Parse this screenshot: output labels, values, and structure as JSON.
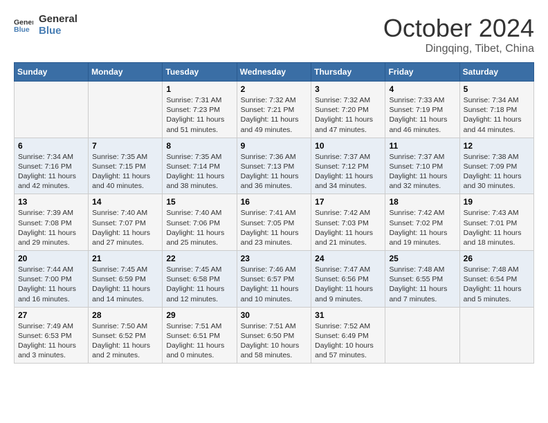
{
  "logo": {
    "line1": "General",
    "line2": "Blue"
  },
  "title": {
    "month": "October 2024",
    "location": "Dingqing, Tibet, China"
  },
  "headers": [
    "Sunday",
    "Monday",
    "Tuesday",
    "Wednesday",
    "Thursday",
    "Friday",
    "Saturday"
  ],
  "weeks": [
    [
      {
        "num": "",
        "lines": []
      },
      {
        "num": "",
        "lines": []
      },
      {
        "num": "1",
        "lines": [
          "Sunrise: 7:31 AM",
          "Sunset: 7:23 PM",
          "Daylight: 11 hours",
          "and 51 minutes."
        ]
      },
      {
        "num": "2",
        "lines": [
          "Sunrise: 7:32 AM",
          "Sunset: 7:21 PM",
          "Daylight: 11 hours",
          "and 49 minutes."
        ]
      },
      {
        "num": "3",
        "lines": [
          "Sunrise: 7:32 AM",
          "Sunset: 7:20 PM",
          "Daylight: 11 hours",
          "and 47 minutes."
        ]
      },
      {
        "num": "4",
        "lines": [
          "Sunrise: 7:33 AM",
          "Sunset: 7:19 PM",
          "Daylight: 11 hours",
          "and 46 minutes."
        ]
      },
      {
        "num": "5",
        "lines": [
          "Sunrise: 7:34 AM",
          "Sunset: 7:18 PM",
          "Daylight: 11 hours",
          "and 44 minutes."
        ]
      }
    ],
    [
      {
        "num": "6",
        "lines": [
          "Sunrise: 7:34 AM",
          "Sunset: 7:16 PM",
          "Daylight: 11 hours",
          "and 42 minutes."
        ]
      },
      {
        "num": "7",
        "lines": [
          "Sunrise: 7:35 AM",
          "Sunset: 7:15 PM",
          "Daylight: 11 hours",
          "and 40 minutes."
        ]
      },
      {
        "num": "8",
        "lines": [
          "Sunrise: 7:35 AM",
          "Sunset: 7:14 PM",
          "Daylight: 11 hours",
          "and 38 minutes."
        ]
      },
      {
        "num": "9",
        "lines": [
          "Sunrise: 7:36 AM",
          "Sunset: 7:13 PM",
          "Daylight: 11 hours",
          "and 36 minutes."
        ]
      },
      {
        "num": "10",
        "lines": [
          "Sunrise: 7:37 AM",
          "Sunset: 7:12 PM",
          "Daylight: 11 hours",
          "and 34 minutes."
        ]
      },
      {
        "num": "11",
        "lines": [
          "Sunrise: 7:37 AM",
          "Sunset: 7:10 PM",
          "Daylight: 11 hours",
          "and 32 minutes."
        ]
      },
      {
        "num": "12",
        "lines": [
          "Sunrise: 7:38 AM",
          "Sunset: 7:09 PM",
          "Daylight: 11 hours",
          "and 30 minutes."
        ]
      }
    ],
    [
      {
        "num": "13",
        "lines": [
          "Sunrise: 7:39 AM",
          "Sunset: 7:08 PM",
          "Daylight: 11 hours",
          "and 29 minutes."
        ]
      },
      {
        "num": "14",
        "lines": [
          "Sunrise: 7:40 AM",
          "Sunset: 7:07 PM",
          "Daylight: 11 hours",
          "and 27 minutes."
        ]
      },
      {
        "num": "15",
        "lines": [
          "Sunrise: 7:40 AM",
          "Sunset: 7:06 PM",
          "Daylight: 11 hours",
          "and 25 minutes."
        ]
      },
      {
        "num": "16",
        "lines": [
          "Sunrise: 7:41 AM",
          "Sunset: 7:05 PM",
          "Daylight: 11 hours",
          "and 23 minutes."
        ]
      },
      {
        "num": "17",
        "lines": [
          "Sunrise: 7:42 AM",
          "Sunset: 7:03 PM",
          "Daylight: 11 hours",
          "and 21 minutes."
        ]
      },
      {
        "num": "18",
        "lines": [
          "Sunrise: 7:42 AM",
          "Sunset: 7:02 PM",
          "Daylight: 11 hours",
          "and 19 minutes."
        ]
      },
      {
        "num": "19",
        "lines": [
          "Sunrise: 7:43 AM",
          "Sunset: 7:01 PM",
          "Daylight: 11 hours",
          "and 18 minutes."
        ]
      }
    ],
    [
      {
        "num": "20",
        "lines": [
          "Sunrise: 7:44 AM",
          "Sunset: 7:00 PM",
          "Daylight: 11 hours",
          "and 16 minutes."
        ]
      },
      {
        "num": "21",
        "lines": [
          "Sunrise: 7:45 AM",
          "Sunset: 6:59 PM",
          "Daylight: 11 hours",
          "and 14 minutes."
        ]
      },
      {
        "num": "22",
        "lines": [
          "Sunrise: 7:45 AM",
          "Sunset: 6:58 PM",
          "Daylight: 11 hours",
          "and 12 minutes."
        ]
      },
      {
        "num": "23",
        "lines": [
          "Sunrise: 7:46 AM",
          "Sunset: 6:57 PM",
          "Daylight: 11 hours",
          "and 10 minutes."
        ]
      },
      {
        "num": "24",
        "lines": [
          "Sunrise: 7:47 AM",
          "Sunset: 6:56 PM",
          "Daylight: 11 hours",
          "and 9 minutes."
        ]
      },
      {
        "num": "25",
        "lines": [
          "Sunrise: 7:48 AM",
          "Sunset: 6:55 PM",
          "Daylight: 11 hours",
          "and 7 minutes."
        ]
      },
      {
        "num": "26",
        "lines": [
          "Sunrise: 7:48 AM",
          "Sunset: 6:54 PM",
          "Daylight: 11 hours",
          "and 5 minutes."
        ]
      }
    ],
    [
      {
        "num": "27",
        "lines": [
          "Sunrise: 7:49 AM",
          "Sunset: 6:53 PM",
          "Daylight: 11 hours",
          "and 3 minutes."
        ]
      },
      {
        "num": "28",
        "lines": [
          "Sunrise: 7:50 AM",
          "Sunset: 6:52 PM",
          "Daylight: 11 hours",
          "and 2 minutes."
        ]
      },
      {
        "num": "29",
        "lines": [
          "Sunrise: 7:51 AM",
          "Sunset: 6:51 PM",
          "Daylight: 11 hours",
          "and 0 minutes."
        ]
      },
      {
        "num": "30",
        "lines": [
          "Sunrise: 7:51 AM",
          "Sunset: 6:50 PM",
          "Daylight: 10 hours",
          "and 58 minutes."
        ]
      },
      {
        "num": "31",
        "lines": [
          "Sunrise: 7:52 AM",
          "Sunset: 6:49 PM",
          "Daylight: 10 hours",
          "and 57 minutes."
        ]
      },
      {
        "num": "",
        "lines": []
      },
      {
        "num": "",
        "lines": []
      }
    ]
  ]
}
